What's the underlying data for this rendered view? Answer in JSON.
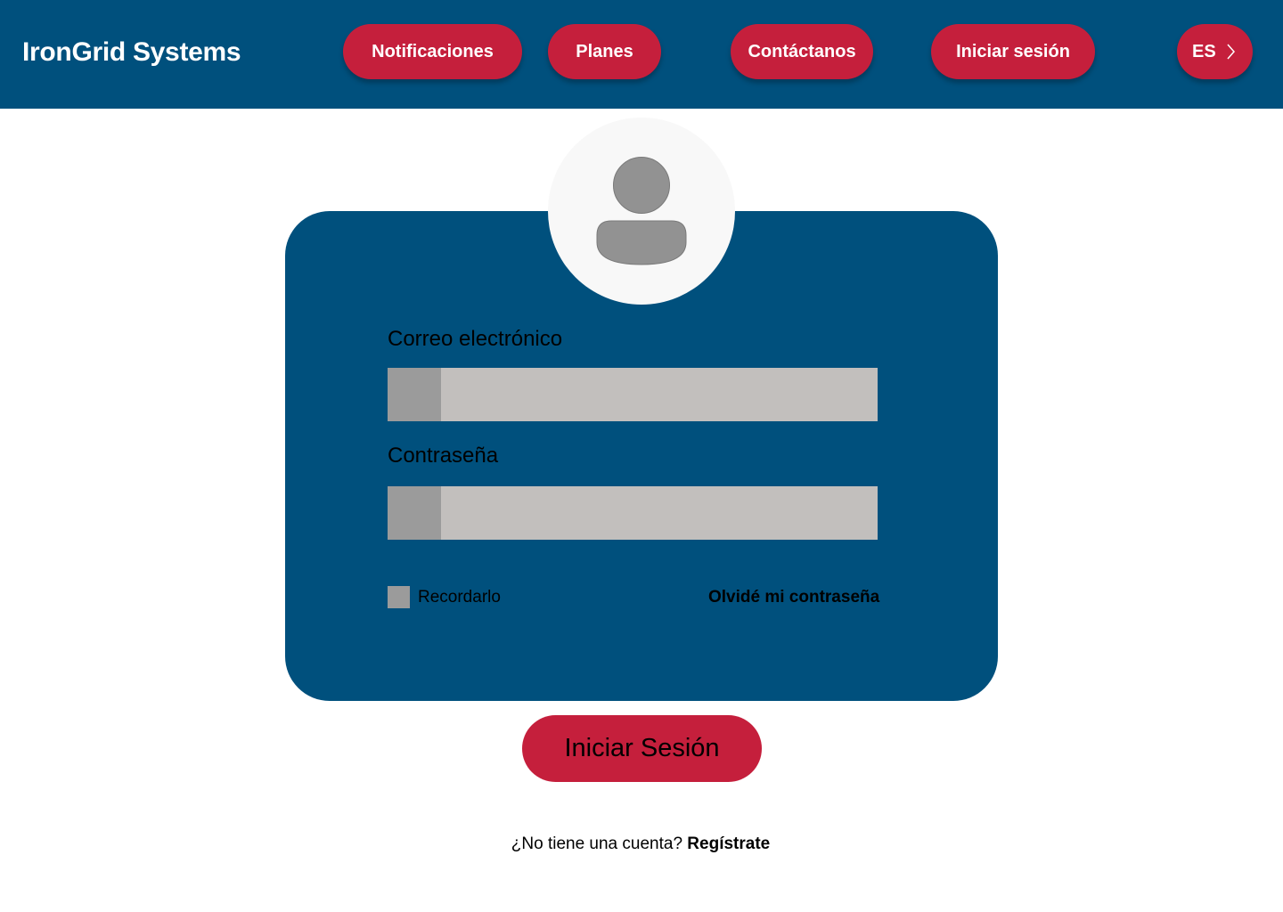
{
  "header": {
    "brand": "IronGrid Systems",
    "nav": {
      "notifications": "Notificaciones",
      "plans": "Planes",
      "contact": "Contáctanos",
      "login": "Iniciar sesión",
      "language": "ES"
    }
  },
  "form": {
    "email_label": "Correo electrónico",
    "password_label": "Contraseña",
    "remember_label": "Recordarlo",
    "forgot_label": "Olvidé mi contraseña",
    "submit_label": "Iniciar Sesión"
  },
  "signup": {
    "question": "¿No tiene una cuenta?",
    "link": "Regístrate"
  },
  "colors": {
    "primary": "#00507d",
    "accent": "#c51f3c",
    "input_bg": "#c2bfbd",
    "icon_box": "#9b9b9b"
  },
  "icons": {
    "avatar": "user-avatar-icon",
    "language": "chevron-right-icon"
  }
}
